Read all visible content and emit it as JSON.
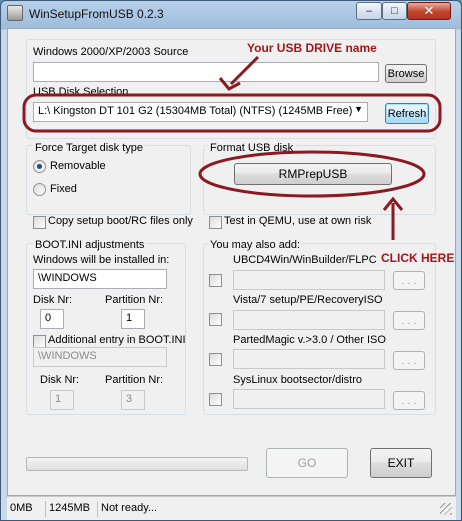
{
  "window": {
    "title": "WinSetupFromUSB 0.2.3",
    "minimize_symbol": "–",
    "maximize_symbol": "□",
    "close_symbol": "✕"
  },
  "source": {
    "label": "Windows 2000/XP/2003 Source",
    "value": "",
    "browse_label": "Browse"
  },
  "usb": {
    "label": "USB Disk Selection",
    "selected": "L:\\ Kingston DT 101 G2 (15304MB Total) (NTFS) (1245MB Free)",
    "refresh_label": "Refresh"
  },
  "force_target": {
    "label": "Force Target disk type",
    "removable_label": "Removable",
    "removable_checked": true,
    "fixed_label": "Fixed",
    "fixed_checked": false
  },
  "format": {
    "label": "Format USB disk",
    "button_label": "RMPrepUSB"
  },
  "options": {
    "copy_setup_label": "Copy setup boot/RC files only",
    "test_qemu_label": "Test in QEMU, use at own risk"
  },
  "bootini": {
    "label": "BOOT.INI adjustments",
    "install_label": "Windows will be installed in:",
    "install_value": "\\WINDOWS",
    "disk_nr_label": "Disk Nr:",
    "disk_nr_value": "0",
    "partition_nr_label": "Partition Nr:",
    "partition_nr_value": "1",
    "additional_label": "Additional entry in BOOT.INI",
    "additional_value": "\\WINDOWS",
    "add_disk_nr_label": "Disk Nr:",
    "add_disk_nr_value": "1",
    "add_partition_nr_label": "Partition Nr:",
    "add_partition_nr_value": "3"
  },
  "also_add": {
    "label": "You may also add:",
    "items": [
      {
        "label": "UBCD4Win/WinBuilder/FLPC",
        "browse": ". . ."
      },
      {
        "label": "Vista/7 setup/PE/RecoveryISO",
        "browse": ". . ."
      },
      {
        "label": "PartedMagic v.>3.0 / Other ISO",
        "browse": ". . ."
      },
      {
        "label": "SysLinux bootsector/distro",
        "browse": ". . ."
      }
    ]
  },
  "actions": {
    "go_label": "GO",
    "exit_label": "EXIT",
    "progress": 0
  },
  "status": {
    "size": "0MB",
    "free": "1245MB",
    "message": "Not ready..."
  },
  "annotations": {
    "usb_drive": "Your USB DRIVE name",
    "click_here": "CLICK HERE",
    "color": "#a4161a"
  }
}
